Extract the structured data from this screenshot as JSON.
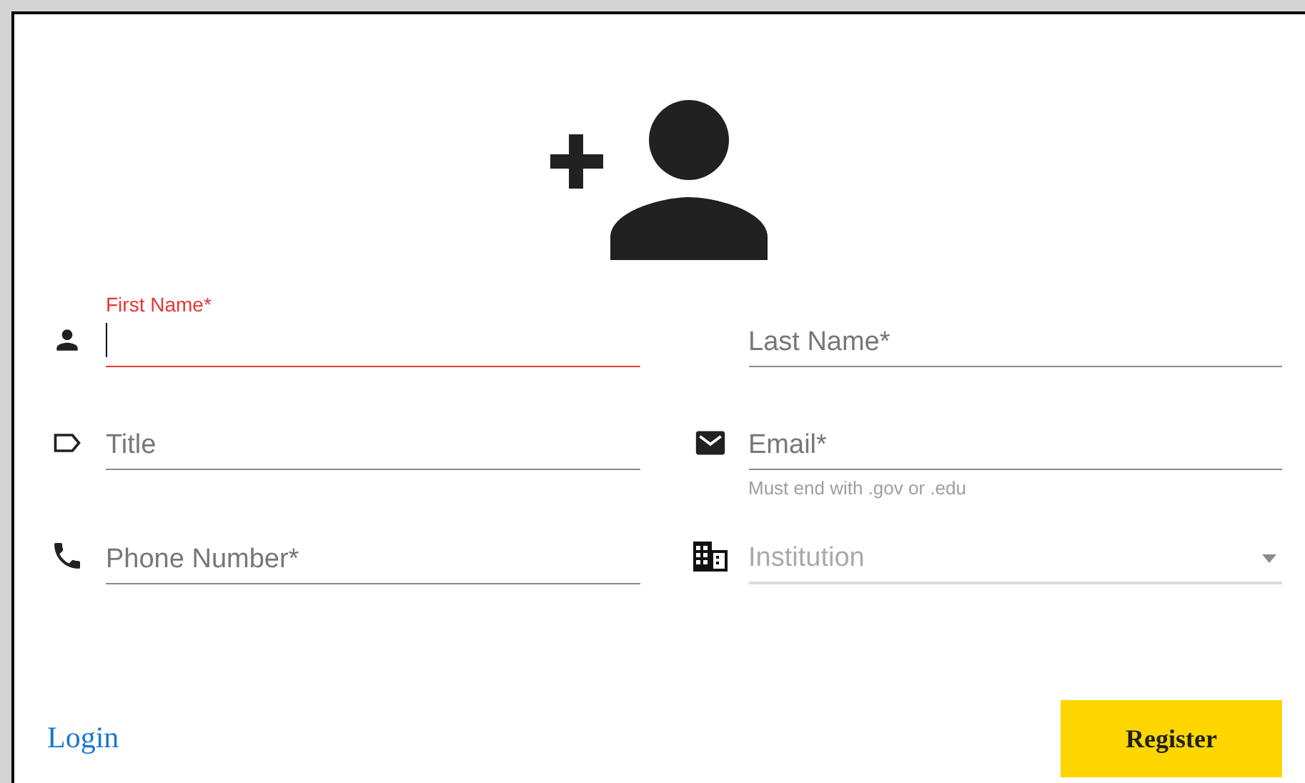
{
  "fields": [
    {
      "kind": "text",
      "placeholder": "First Name*",
      "focused": true
    },
    {
      "kind": "text",
      "placeholder": "Last Name*",
      "focused": false
    },
    {
      "kind": "text",
      "placeholder": "Title",
      "focused": false
    },
    {
      "kind": "text",
      "placeholder": "Email*",
      "focused": false,
      "helper": "Must end with .gov or .edu"
    },
    {
      "kind": "text",
      "placeholder": "Phone Number*",
      "focused": false
    },
    {
      "kind": "select",
      "placeholder": "Institution",
      "focused": false
    }
  ],
  "login_link": "Login",
  "register_button": "Register"
}
